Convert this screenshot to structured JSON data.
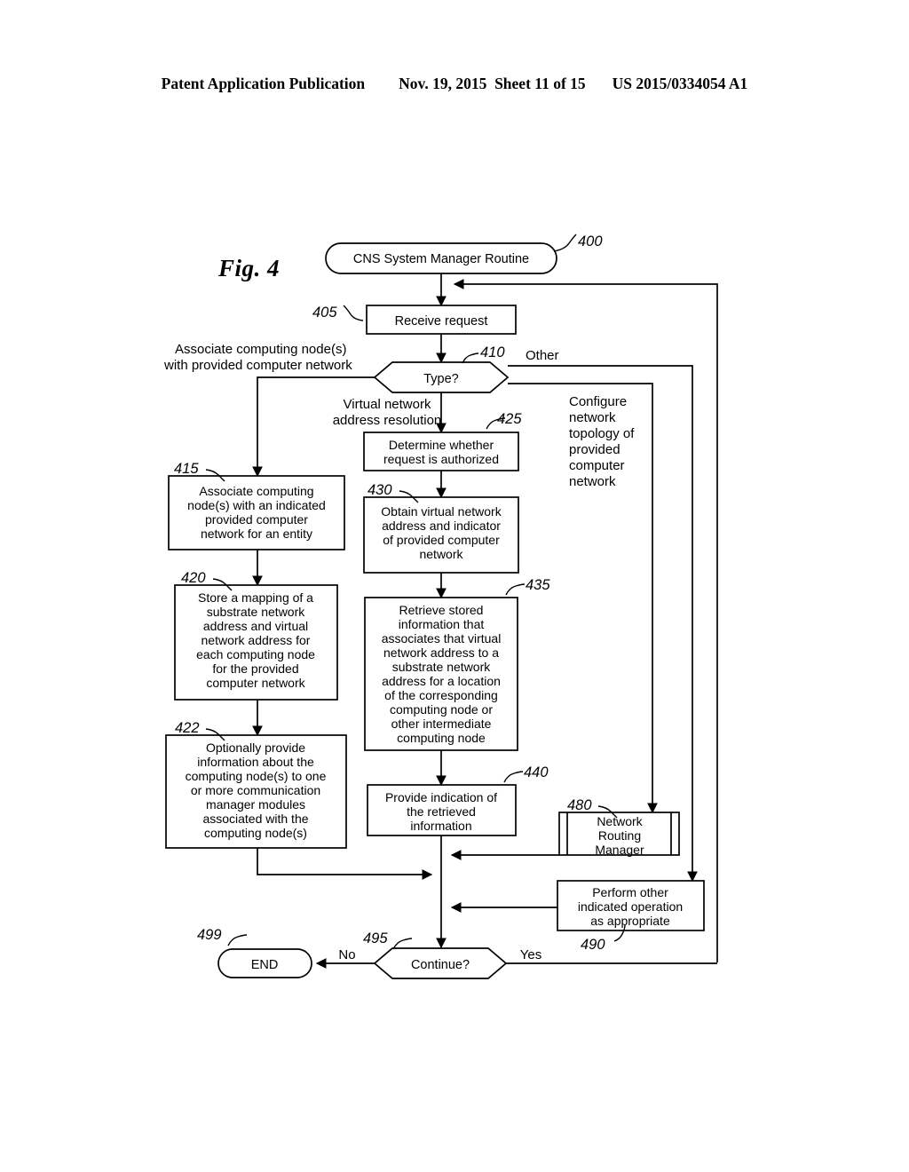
{
  "header": {
    "publication": "Patent Application Publication",
    "date": "Nov. 19, 2015",
    "sheet": "Sheet 11 of 15",
    "patent_number": "US 2015/0334054 A1"
  },
  "figure": {
    "label": "Fig. 4"
  },
  "nodes": {
    "start": {
      "ref": "400",
      "text": "CNS System Manager Routine"
    },
    "receive": {
      "ref": "405",
      "text": "Receive request"
    },
    "type": {
      "ref": "410",
      "text": "Type?"
    },
    "associate": {
      "ref": "415",
      "lines": [
        "Associate computing",
        "node(s) with an indicated",
        "provided computer",
        "network for an entity"
      ]
    },
    "store": {
      "ref": "420",
      "lines": [
        "Store a mapping of a",
        "substrate network",
        "address and virtual",
        "network address for",
        "each computing node",
        "for the provided",
        "computer network"
      ]
    },
    "optionally": {
      "ref": "422",
      "lines": [
        "Optionally provide",
        "information about the",
        "computing node(s) to one",
        "or more communication",
        "manager modules",
        "associated with the",
        "computing node(s)"
      ]
    },
    "determine": {
      "ref": "425",
      "lines": [
        "Determine whether",
        "request is authorized"
      ]
    },
    "obtain": {
      "ref": "430",
      "lines": [
        "Obtain virtual network",
        "address and indicator",
        "of provided computer",
        "network"
      ]
    },
    "retrieve": {
      "ref": "435",
      "lines": [
        "Retrieve stored",
        "information that",
        "associates that virtual",
        "network address to a",
        "substrate network",
        "address for a location",
        "of the corresponding",
        "computing node or",
        "other intermediate",
        "computing node"
      ]
    },
    "provide": {
      "ref": "440",
      "lines": [
        "Provide indication of",
        "the retrieved",
        "information"
      ]
    },
    "routing_manager": {
      "ref": "480",
      "lines": [
        "Network",
        "Routing",
        "Manager"
      ]
    },
    "perform_other": {
      "ref": "490",
      "lines": [
        "Perform other",
        "indicated operation",
        "as appropriate"
      ]
    },
    "continue": {
      "ref": "495",
      "text": "Continue?"
    },
    "end": {
      "ref": "499",
      "text": "END"
    }
  },
  "edge_labels": {
    "associate_branch": [
      "Associate computing node(s)",
      "with provided computer network"
    ],
    "virtual_branch": [
      "Virtual network",
      "address resolution"
    ],
    "other_branch": "Other",
    "configure_branch": [
      "Configure",
      "network",
      "topology of",
      "provided",
      "computer",
      "network"
    ],
    "continue_no": "No",
    "continue_yes": "Yes"
  }
}
